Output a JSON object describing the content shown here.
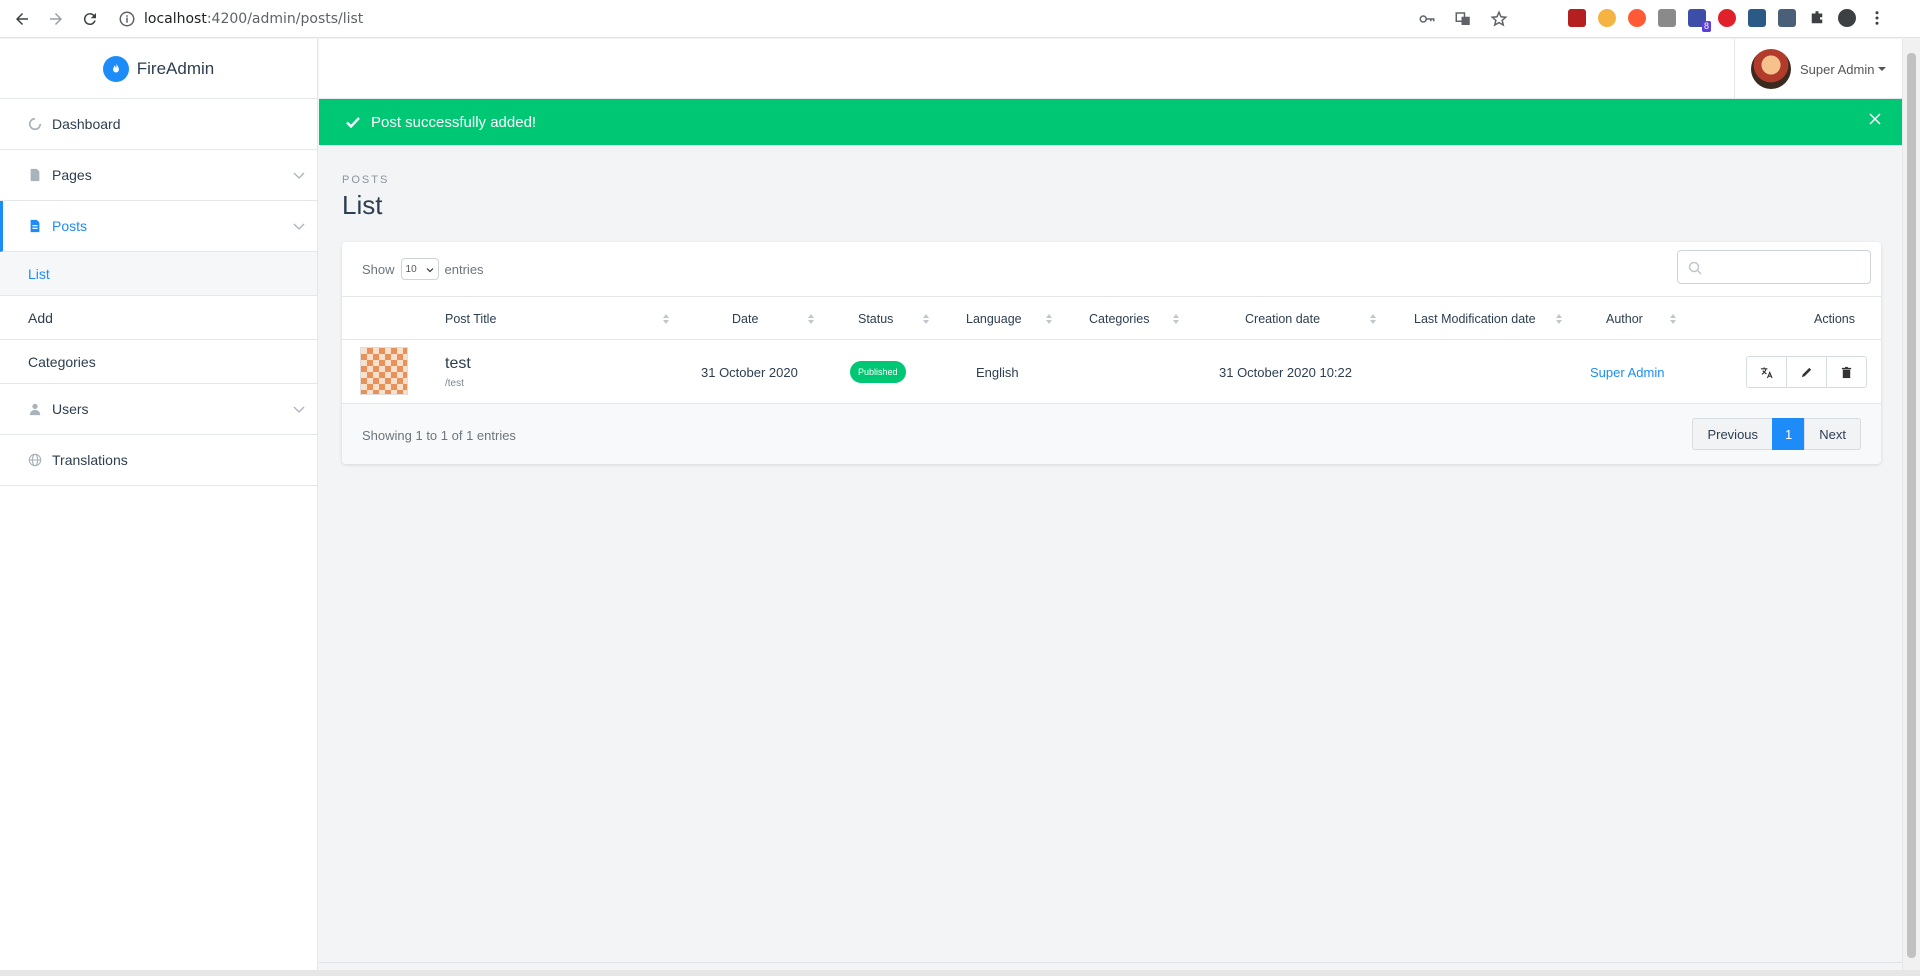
{
  "browser": {
    "url_host": "localhost",
    "url_path": ":4200/admin/posts/list",
    "extension_badge": "8"
  },
  "sidebar": {
    "brand": "FireAdmin",
    "items": [
      {
        "label": "Dashboard",
        "icon": "dashboard-icon"
      },
      {
        "label": "Pages",
        "icon": "page-icon"
      },
      {
        "label": "Posts",
        "icon": "post-icon"
      },
      {
        "label": "Users",
        "icon": "user-icon"
      },
      {
        "label": "Translations",
        "icon": "globe-icon"
      }
    ],
    "posts_submenu": [
      "List",
      "Add",
      "Categories"
    ]
  },
  "topbar": {
    "user_name": "Super Admin"
  },
  "alert": {
    "message": "Post successfully added!"
  },
  "page": {
    "eyebrow": "POSTS",
    "title": "List"
  },
  "table_controls": {
    "show_label": "Show",
    "entries_label": "entries",
    "page_length": "10"
  },
  "table": {
    "columns": [
      "Post Title",
      "Date",
      "Status",
      "Language",
      "Categories",
      "Creation date",
      "Last Modification date",
      "Author",
      "Actions"
    ],
    "rows": [
      {
        "title": "test",
        "slug": "/test",
        "date": "31 October 2020",
        "status": "Published",
        "language": "English",
        "categories": "",
        "creation_date": "31 October 2020 10:22",
        "last_modification": "",
        "author": "Super Admin"
      }
    ]
  },
  "footer": {
    "info": "Showing 1 to 1 of 1 entries",
    "prev": "Previous",
    "current_page": "1",
    "next": "Next"
  },
  "colors": {
    "accent": "#1d8cf8",
    "success": "#00c774"
  }
}
